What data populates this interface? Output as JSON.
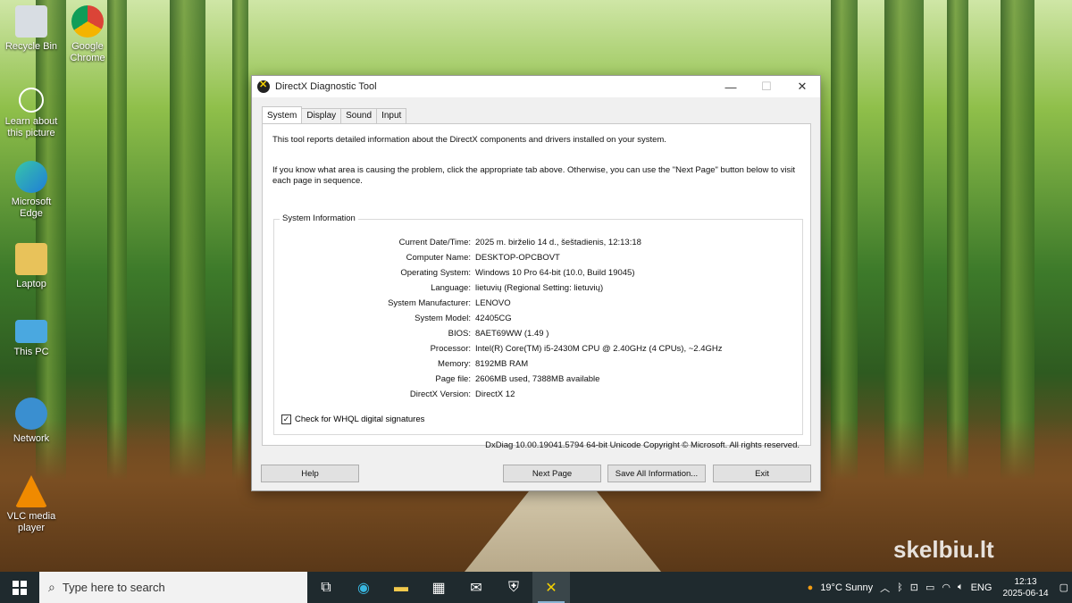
{
  "desktop": {
    "icons": [
      {
        "label": "Recycle Bin",
        "icon": "recycle-bin-icon"
      },
      {
        "label": "Google Chrome",
        "icon": "chrome-icon"
      },
      {
        "label": "Learn about this picture",
        "icon": "learn-about-picture-icon"
      },
      {
        "label": "Microsoft Edge",
        "icon": "edge-icon"
      },
      {
        "label": "Laptop",
        "icon": "laptop-folder-icon"
      },
      {
        "label": "This PC",
        "icon": "this-pc-icon"
      },
      {
        "label": "Network",
        "icon": "network-icon"
      },
      {
        "label": "VLC media player",
        "icon": "vlc-icon"
      }
    ],
    "watermark": "skelbiu.lt"
  },
  "window": {
    "title": "DirectX Diagnostic Tool",
    "tabs": [
      "System",
      "Display",
      "Sound",
      "Input"
    ],
    "intro_1": "This tool reports detailed information about the DirectX components and drivers installed on your system.",
    "intro_2": "If you know what area is causing the problem, click the appropriate tab above.  Otherwise, you can use the \"Next Page\" button below to visit each page in sequence.",
    "group_title": "System Information",
    "info": [
      {
        "label": "Current Date/Time:",
        "value": "2025 m. birželio 14 d., šeštadienis, 12:13:18"
      },
      {
        "label": "Computer Name:",
        "value": "DESKTOP-OPCBOVT"
      },
      {
        "label": "Operating System:",
        "value": "Windows 10 Pro 64-bit (10.0, Build 19045)"
      },
      {
        "label": "Language:",
        "value": "lietuvių (Regional Setting: lietuvių)"
      },
      {
        "label": "System Manufacturer:",
        "value": "LENOVO"
      },
      {
        "label": "System Model:",
        "value": "42405CG"
      },
      {
        "label": "BIOS:",
        "value": "8AET69WW (1.49 )"
      },
      {
        "label": "Processor:",
        "value": "Intel(R) Core(TM) i5-2430M CPU @ 2.40GHz (4 CPUs), ~2.4GHz"
      },
      {
        "label": "Memory:",
        "value": "8192MB RAM"
      },
      {
        "label": "Page file:",
        "value": "2606MB used, 7388MB available"
      },
      {
        "label": "DirectX Version:",
        "value": "DirectX 12"
      }
    ],
    "whql_label": "Check for WHQL digital signatures",
    "whql_checked": true,
    "footer": "DxDiag 10.00.19041.5794 64-bit Unicode  Copyright © Microsoft. All rights reserved.",
    "buttons": {
      "help": "Help",
      "next": "Next Page",
      "save": "Save All Information...",
      "exit": "Exit"
    }
  },
  "taskbar": {
    "search_placeholder": "Type here to search",
    "weather": "19°C  Sunny",
    "language": "ENG",
    "time": "12:13",
    "date": "2025-06-14"
  }
}
